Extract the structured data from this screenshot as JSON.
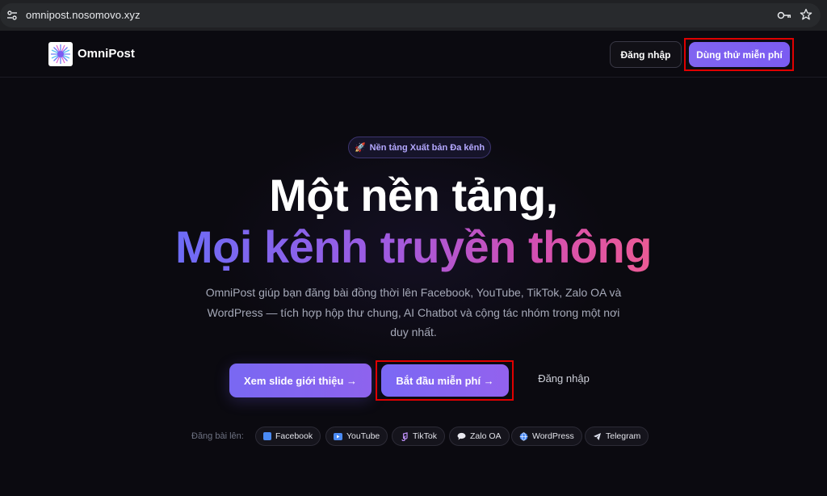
{
  "browser": {
    "url": "omnipost.nosomovo.xyz"
  },
  "nav": {
    "logo_text": "OmniPost",
    "login_label": "Đăng nhập",
    "trial_label": "Dùng thử miễn phí"
  },
  "hero": {
    "badge_icon": "🚀",
    "badge_text": "Nền tảng Xuất bản Đa kênh",
    "title_line1": "Một nền tảng,",
    "title_line2": "Mọi kênh truyền thông",
    "subtitle": "OmniPost giúp bạn đăng bài đồng thời lên Facebook, YouTube, TikTok, Zalo OA và WordPress — tích hợp hộp thư chung, AI Chatbot và cộng tác nhóm trong một nơi duy nhất.",
    "cta_slide": "Xem slide giới thiệu →",
    "cta_start": "Bắt đầu miễn phí →",
    "cta_login": "Đăng nhập"
  },
  "platforms": {
    "label": "Đăng bài lên:",
    "items": [
      {
        "icon": "facebook-icon",
        "label": "Facebook"
      },
      {
        "icon": "youtube-icon",
        "label": "YouTube"
      },
      {
        "icon": "tiktok-icon",
        "label": "TikTok"
      },
      {
        "icon": "zalo-icon",
        "label": "Zalo OA"
      },
      {
        "icon": "wordpress-icon",
        "label": "WordPress"
      },
      {
        "icon": "telegram-icon",
        "label": "Telegram"
      }
    ]
  },
  "colors": {
    "accent": "#7b5cf2",
    "background": "#0b0a10",
    "highlight_box": "#e00000"
  }
}
